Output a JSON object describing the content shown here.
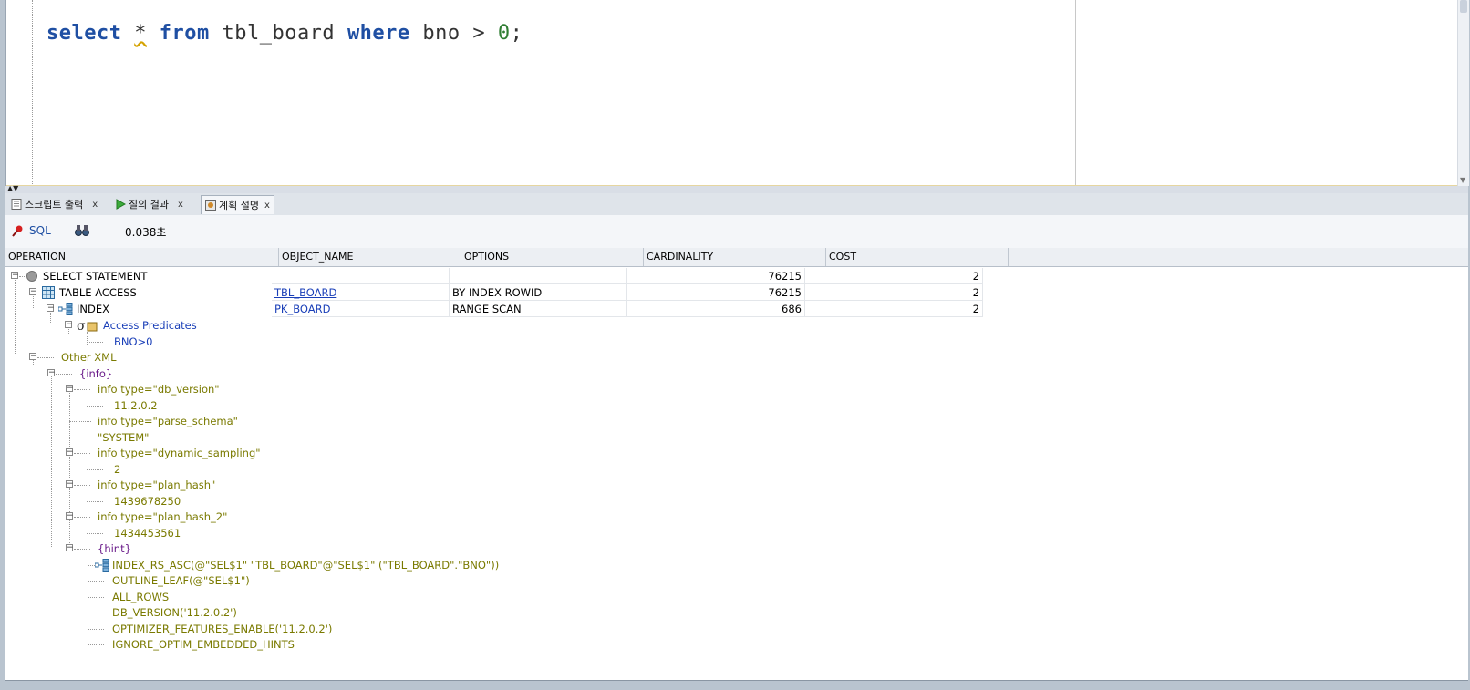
{
  "editor": {
    "tokens": {
      "select": "select",
      "star": "*",
      "from": "from",
      "table": "tbl_board",
      "where": "where",
      "col": "bno",
      "op": ">",
      "val": "0",
      "semi": ";"
    }
  },
  "tabs": [
    {
      "label": "스크립트 출력",
      "close": "x"
    },
    {
      "label": "질의 결과",
      "close": "x"
    },
    {
      "label": "계획 설명",
      "close": "x"
    }
  ],
  "toolbar": {
    "sql_label": "SQL",
    "elapsed": "0.038초"
  },
  "grid": {
    "columns": [
      "OPERATION",
      "OBJECT_NAME",
      "OPTIONS",
      "CARDINALITY",
      "COST"
    ],
    "rows": [
      {
        "operation": "SELECT STATEMENT",
        "object_name": "",
        "options": "",
        "cardinality": "76215",
        "cost": "2"
      },
      {
        "operation": "TABLE ACCESS",
        "object_name": "TBL_BOARD",
        "options": "BY INDEX ROWID",
        "cardinality": "76215",
        "cost": "2"
      },
      {
        "operation": "INDEX",
        "object_name": "PK_BOARD",
        "options": "RANGE SCAN",
        "cardinality": "686",
        "cost": "2"
      }
    ],
    "predicates": {
      "label": "Access Predicates",
      "value": "BNO>0"
    },
    "other_xml": {
      "label": "Other XML",
      "info": "{info}",
      "db_version_label": "info type=\"db_version\"",
      "db_version": "11.2.0.2",
      "parse_schema_label": "info type=\"parse_schema\"",
      "parse_schema": "\"SYSTEM\"",
      "dynamic_sampling_label": "info type=\"dynamic_sampling\"",
      "dynamic_sampling": "2",
      "plan_hash_label": "info type=\"plan_hash\"",
      "plan_hash": "1439678250",
      "plan_hash_2_label": "info type=\"plan_hash_2\"",
      "plan_hash_2": "1434453561",
      "hint": "{hint}",
      "hints": [
        "INDEX_RS_ASC(@\"SEL$1\" \"TBL_BOARD\"@\"SEL$1\" (\"TBL_BOARD\".\"BNO\"))",
        "OUTLINE_LEAF(@\"SEL$1\")",
        "ALL_ROWS",
        "DB_VERSION('11.2.0.2')",
        "OPTIMIZER_FEATURES_ENABLE('11.2.0.2')",
        "IGNORE_OPTIM_EMBEDDED_HINTS"
      ]
    }
  }
}
